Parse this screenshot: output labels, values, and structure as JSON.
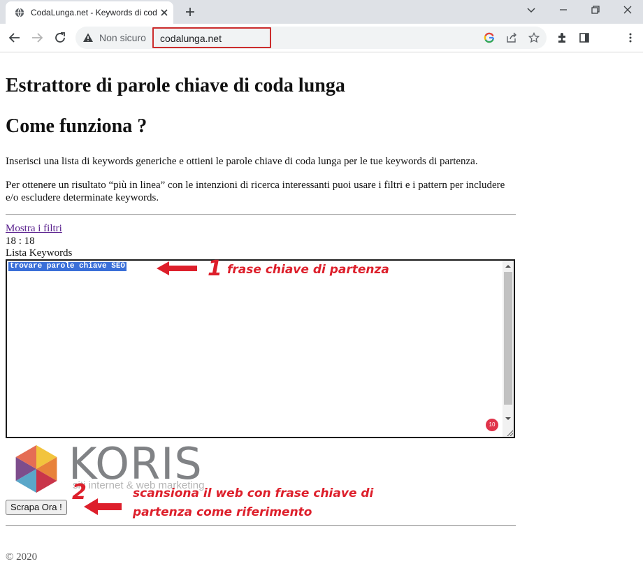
{
  "browser": {
    "tab_title": "CodaLunga.net - Keywords di coda lunga",
    "security_label": "Non sicuro",
    "url": "codalunga.net"
  },
  "page": {
    "heading": "Estrattore di parole chiave di coda lunga",
    "subheading": "Come funziona ?",
    "intro": "Inserisci una lista di keywords generiche e ottieni le parole chiave di coda lunga per le tue keywords di partenza.",
    "filters_text": "Per ottenere un risultato “più in linea” con le intenzioni di ricerca interessanti puoi usare i filtri e i pattern per includere e/o escludere determinate keywords.",
    "show_filters_link": "Mostra i filtri",
    "counter": "18 : 18",
    "keywords_label": "Lista Keywords",
    "keywords_value": "trovare parole chiave SEO",
    "grammar_count": "10",
    "logo_word": "KORIS",
    "logo_tagline": "siti internet & web marketing",
    "scrape_button": "Scrapa Ora !",
    "footer": "© 2020"
  },
  "annotations": {
    "step1_number": "1",
    "step1_text": "frase chiave di partenza",
    "step2_number": "2",
    "step2_line1": "scansiona il web con frase chiave di",
    "step2_line2": "partenza come riferimento"
  },
  "colors": {
    "annotation": "#dd1f2b",
    "selection": "#3a6fd8",
    "url_highlight": "#cc2d2d",
    "link": "#551a8b"
  }
}
